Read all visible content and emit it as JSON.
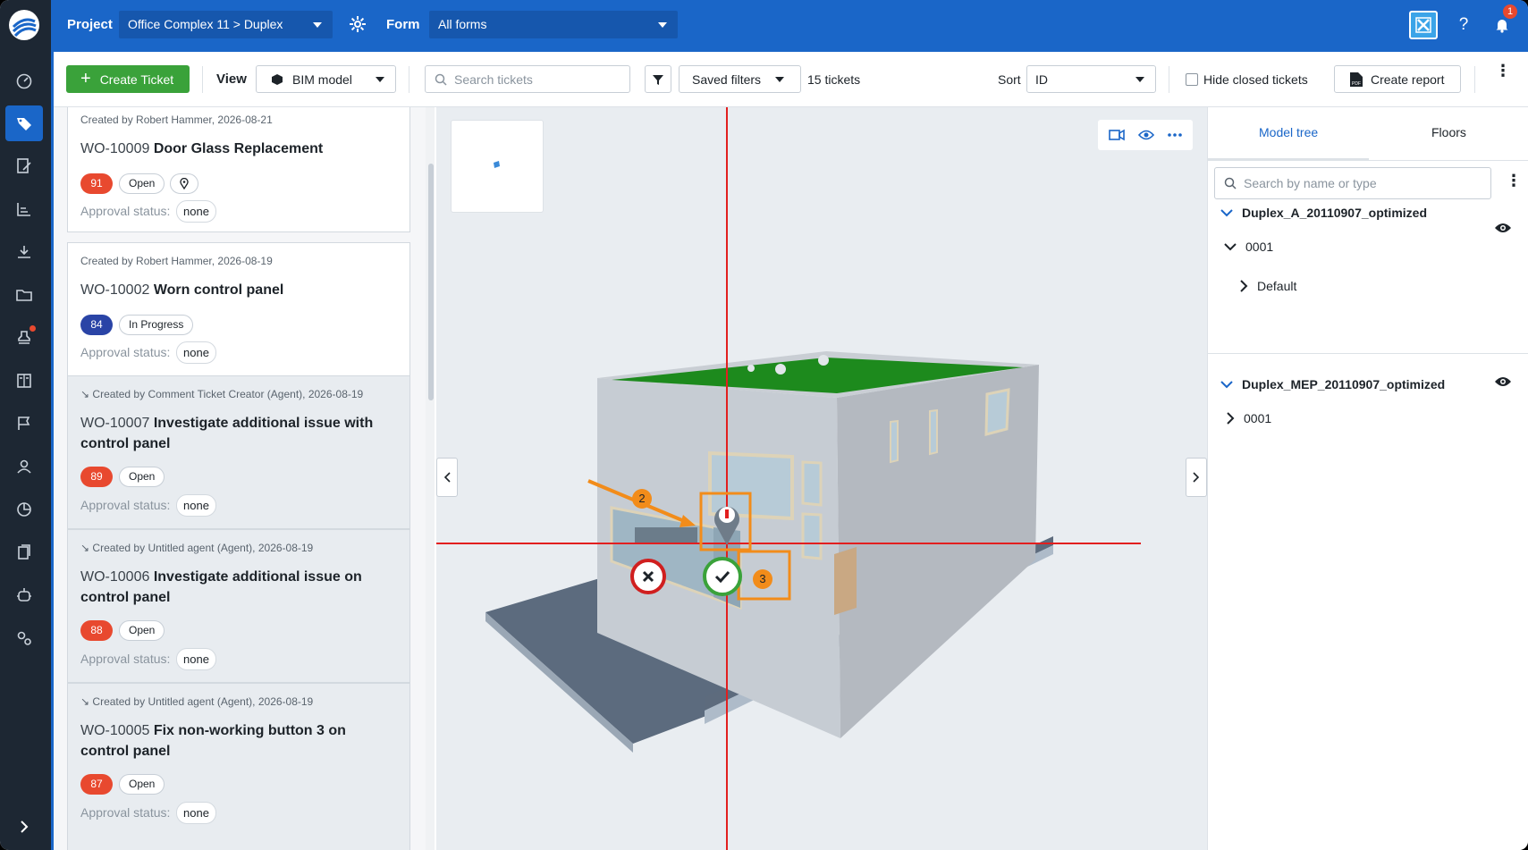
{
  "header": {
    "project_label": "Project",
    "project_value": "Office Complex 11 > Duplex",
    "form_label": "Form",
    "form_value": "All forms",
    "notifications_count": "1"
  },
  "toolbar": {
    "create_label": "Create Ticket",
    "view_label": "View",
    "view_value": "BIM model",
    "search_placeholder": "Search tickets",
    "saved_filters_label": "Saved filters",
    "ticket_count": "15 tickets",
    "sort_label": "Sort",
    "sort_value": "ID",
    "hide_closed_label": "Hide closed tickets",
    "create_report_label": "Create report"
  },
  "tickets": [
    {
      "meta": "Created by Robert Hammer, 2026-08-21",
      "id": "WO-10009",
      "title": "Door Glass Replacement",
      "priority": "91",
      "priority_color": "#e8492f",
      "status": "Open",
      "approval_label": "Approval status:",
      "approval": "none"
    },
    {
      "meta": "Created by Robert Hammer, 2026-08-19",
      "id": "WO-10002",
      "title": "Worn control panel",
      "priority": "84",
      "priority_color": "#2a44a6",
      "status": "In Progress",
      "approval_label": "Approval status:",
      "approval": "none"
    },
    {
      "meta": "Created by Comment Ticket Creator (Agent), 2026-08-19",
      "id": "WO-10007",
      "title": "Investigate additional issue with control panel",
      "priority": "89",
      "priority_color": "#e8492f",
      "status": "Open",
      "approval_label": "Approval status:",
      "approval": "none"
    },
    {
      "meta": "Created by Untitled agent (Agent), 2026-08-19",
      "id": "WO-10006",
      "title": "Investigate additional issue on control panel",
      "priority": "88",
      "priority_color": "#e8492f",
      "status": "Open",
      "approval_label": "Approval status:",
      "approval": "none"
    },
    {
      "meta": "Created by Untitled agent (Agent), 2026-08-19",
      "id": "WO-10005",
      "title": "Fix non-working button 3 on control panel",
      "priority": "87",
      "priority_color": "#e8492f",
      "status": "Open",
      "approval_label": "Approval status:",
      "approval": "none"
    }
  ],
  "viewport": {
    "marker_2": "2",
    "marker_3": "3"
  },
  "model_panel": {
    "tab_model_tree": "Model tree",
    "tab_floors": "Floors",
    "search_placeholder": "Search by name or type",
    "model_a": "Duplex_A_20110907_optimized",
    "model_a_level": "0001",
    "model_a_sub": "Default",
    "model_mep": "Duplex_MEP_20110907_optimized",
    "model_mep_level": "0001"
  },
  "colors": {
    "brand_blue": "#1a66c8",
    "create_green": "#3aa23a",
    "priority_red": "#e8492f",
    "priority_blue": "#2a44a6",
    "marker_orange": "#f28c1a"
  }
}
